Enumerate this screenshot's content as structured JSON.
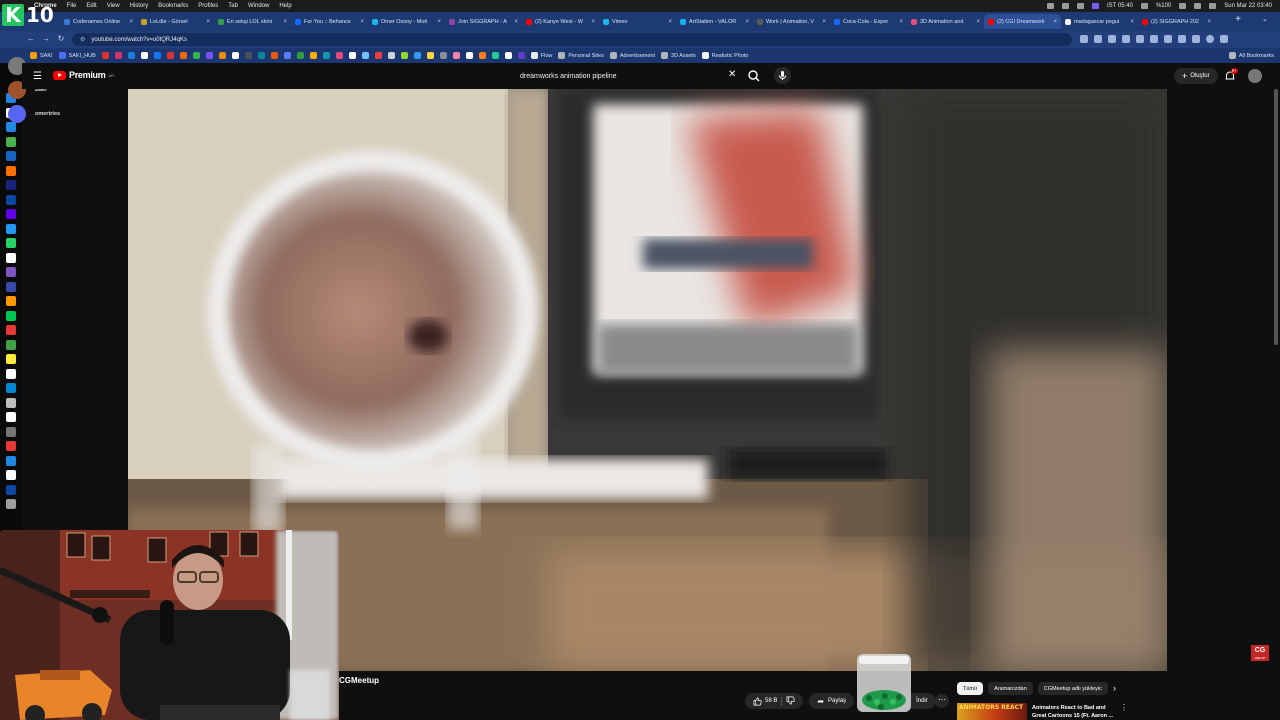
{
  "menubar": {
    "items": [
      "Chrome",
      "File",
      "Edit",
      "View",
      "History",
      "Bookmarks",
      "Profiles",
      "Tab",
      "Window",
      "Help"
    ],
    "clock_small": "IST 05:40",
    "battery": "%100",
    "datetime": "Sun Mar 22  03:40"
  },
  "overlay_logo": {
    "letter": "K",
    "number": "10"
  },
  "tabs": [
    {
      "title": "Codenames Online",
      "color": "#3a7bd5"
    },
    {
      "title": "LoLdle - Görsel",
      "color": "#c9a227"
    },
    {
      "title": "En sekşi LOL skini",
      "color": "#2f9e44"
    },
    {
      "title": "For You :: Behance",
      "color": "#1769ff"
    },
    {
      "title": "Omer Ozsoy - Moti",
      "color": "#1ab7ea"
    },
    {
      "title": "Join SIGGRAPH - A",
      "color": "#8e44ad"
    },
    {
      "title": "(2) Kanye West - W",
      "color": "#ff0000"
    },
    {
      "title": "Vimeo",
      "color": "#1ab7ea"
    },
    {
      "title": "ArtStation - VALOR",
      "color": "#13aff0"
    },
    {
      "title": "Work | Animation, V",
      "color": "#5a5a5a"
    },
    {
      "title": "Coca-Cola - Exper",
      "color": "#1769ff"
    },
    {
      "title": "3D Animation and",
      "color": "#e64980"
    },
    {
      "title": "(2) CGI Dreamwork",
      "color": "#ff0000",
      "active": true
    },
    {
      "title": "madagascar pegui",
      "color": "#f1f1f1"
    },
    {
      "title": "(2) SIGGRAPH 202",
      "color": "#ff0000"
    }
  ],
  "address_bar": {
    "url": "youtube.com/watch?v=u0tQRJ4qKs"
  },
  "bookmarks": [
    {
      "label": "SAKI",
      "color": "#f59f00"
    },
    {
      "label": "SAKI_HUB",
      "color": "#4c6ef5"
    },
    {
      "label": "",
      "color": "#e03131"
    },
    {
      "label": "",
      "color": "#d6336c"
    },
    {
      "label": "",
      "color": "#1c7ed6"
    },
    {
      "label": "",
      "color": "#ffffff"
    },
    {
      "label": "",
      "color": "#1877f2"
    },
    {
      "label": "",
      "color": "#e03131"
    },
    {
      "label": "",
      "color": "#f76707"
    },
    {
      "label": "",
      "color": "#37b24d"
    },
    {
      "label": "",
      "color": "#7950f2"
    },
    {
      "label": "",
      "color": "#f08c00"
    },
    {
      "label": "",
      "color": "#ffffff"
    },
    {
      "label": "",
      "color": "#495057"
    },
    {
      "label": "",
      "color": "#0c8599"
    },
    {
      "label": "",
      "color": "#e8590c"
    },
    {
      "label": "",
      "color": "#5c7cfa"
    },
    {
      "label": "",
      "color": "#2f9e44"
    },
    {
      "label": "",
      "color": "#fab005"
    },
    {
      "label": "",
      "color": "#1098ad"
    },
    {
      "label": "",
      "color": "#e64980"
    },
    {
      "label": "",
      "color": "#ffffff"
    },
    {
      "label": "",
      "color": "#74c0fc"
    },
    {
      "label": "",
      "color": "#f03e3e"
    },
    {
      "label": "",
      "color": "#ced4da"
    },
    {
      "label": "",
      "color": "#94d82d"
    },
    {
      "label": "",
      "color": "#339af0"
    },
    {
      "label": "",
      "color": "#ffd43b"
    },
    {
      "label": "",
      "color": "#868e96"
    },
    {
      "label": "",
      "color": "#f783ac"
    },
    {
      "label": "",
      "color": "#ffffff"
    },
    {
      "label": "",
      "color": "#fd7e14"
    },
    {
      "label": "",
      "color": "#20c997"
    },
    {
      "label": "",
      "color": "#ffffff"
    },
    {
      "label": "",
      "color": "#5f3dc4"
    },
    {
      "label": "Flow",
      "color": "#e9ecef"
    },
    {
      "label": "Personal Sites",
      "color": "#adb5bd"
    },
    {
      "label": "Advertisement",
      "color": "#adb5bd"
    },
    {
      "label": "3D Assets",
      "color": "#adb5bd"
    },
    {
      "label": "Realistic Photo",
      "color": "#f1f3f5"
    }
  ],
  "all_bookmarks_label": "All Bookmarks",
  "left_panel": {
    "user1": "asiyesp",
    "user2": "Baki",
    "discord": "omertries"
  },
  "youtube": {
    "logo_text": "Premium",
    "logo_sup": "AR",
    "search_value": "dreamworks animation pipeline",
    "create_label": "Oluştur",
    "notifications_count": "9+",
    "channel_name": "CGMeetup",
    "like_count": "58 B",
    "share_label": "Paylaş",
    "download_label": "İndir",
    "chips": [
      {
        "label": "Tümü",
        "active": true
      },
      {
        "label": "Aramanızdan",
        "active": false
      },
      {
        "label": "CGMeetup adlı yükleyic",
        "active": false
      }
    ],
    "recommended": {
      "thumb_text": "ANIMATORS REACT",
      "title": "Animators React to Bad and Great Cartoons 15 (Ft. Aaron ..."
    },
    "watermark": {
      "main": "CG",
      "sub": "MEETUP"
    }
  },
  "colors": {
    "tabbar": "#1e3a73",
    "youtube_red": "#ff0000",
    "background": "#0f0f0f",
    "k10_green": "#22c55e"
  },
  "dock_icon_colors": [
    "#1e88e5",
    "#ffffff",
    "#1e88e5",
    "#4caf50",
    "#1565c0",
    "#ff6f00",
    "#1a237e",
    "#0d47a1",
    "#6200ea",
    "#2196f3",
    "#25d366",
    "#ffffff",
    "#7e57c2",
    "#3949ab",
    "#ff9800",
    "#00c853",
    "#e53935",
    "#43a047",
    "#ffeb3b",
    "#ffffff",
    "#0288d1",
    "#bdbdbd",
    "#ffffff",
    "#757575",
    "#e53935",
    "#1e88e5",
    "#ffffff",
    "#0d47a1",
    "#9e9e9e"
  ]
}
